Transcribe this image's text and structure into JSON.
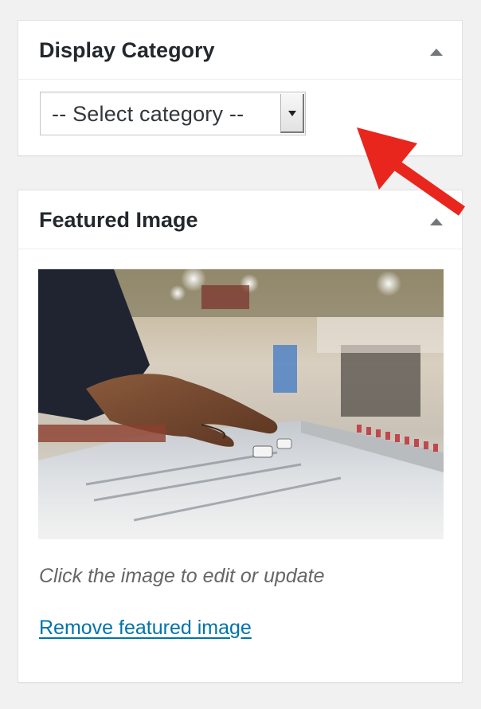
{
  "display_category": {
    "title": "Display Category",
    "select_value": "-- Select category --"
  },
  "featured_image": {
    "title": "Featured Image",
    "hint": "Click the image to edit or update",
    "remove_link": "Remove featured image"
  },
  "colors": {
    "link": "#0073aa",
    "annotation_arrow": "#e8261d",
    "panel_bg": "#ffffff",
    "page_bg": "#f1f1f1"
  },
  "icons": {
    "toggle": "triangle-up-icon",
    "select_arrow": "triangle-down-icon",
    "annotation": "red-arrow-pointer"
  }
}
